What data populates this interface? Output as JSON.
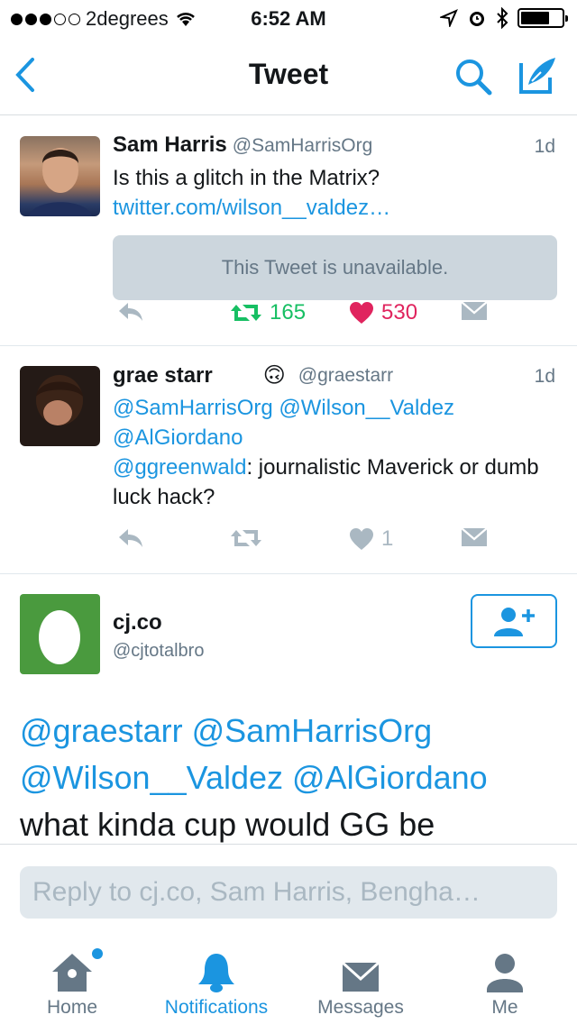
{
  "status_bar": {
    "carrier": "2degrees",
    "time": "6:52 AM"
  },
  "nav": {
    "title": "Tweet"
  },
  "tweets": [
    {
      "name": "Sam Harris",
      "handle": "@SamHarrisOrg",
      "time": "1d",
      "text": "Is this a glitch in the Matrix?",
      "link": "twitter.com/wilson__valdez…",
      "unavailable": "This Tweet is unavailable.",
      "retweets": "165",
      "likes": "530"
    },
    {
      "name": "grae starr",
      "emoji": "🙃",
      "handle": "@graestarr",
      "time": "1d",
      "mentions_line1": "@SamHarrisOrg @Wilson__Valdez",
      "mentions_line2": "@AlGiordano",
      "mention3": "@ggreenwald",
      "text": ": journalistic Maverick or dumb luck hack?",
      "likes": "1"
    }
  ],
  "focused_tweet": {
    "name": "cj.co",
    "handle": "@cjtotalbro",
    "mentions_line1": "@graestarr @SamHarrisOrg",
    "mentions_line2": "@Wilson__Valdez @AlGiordano",
    "text": "what kinda cup would GG be"
  },
  "reply": {
    "placeholder": "Reply to cj.co, Sam Harris, Bengha…"
  },
  "tabs": [
    {
      "label": "Home"
    },
    {
      "label": "Notifications"
    },
    {
      "label": "Messages"
    },
    {
      "label": "Me"
    }
  ],
  "colors": {
    "accent": "#1b95e0",
    "retweet": "#17bf63",
    "like": "#e0245e",
    "muted": "#aab8c2"
  }
}
